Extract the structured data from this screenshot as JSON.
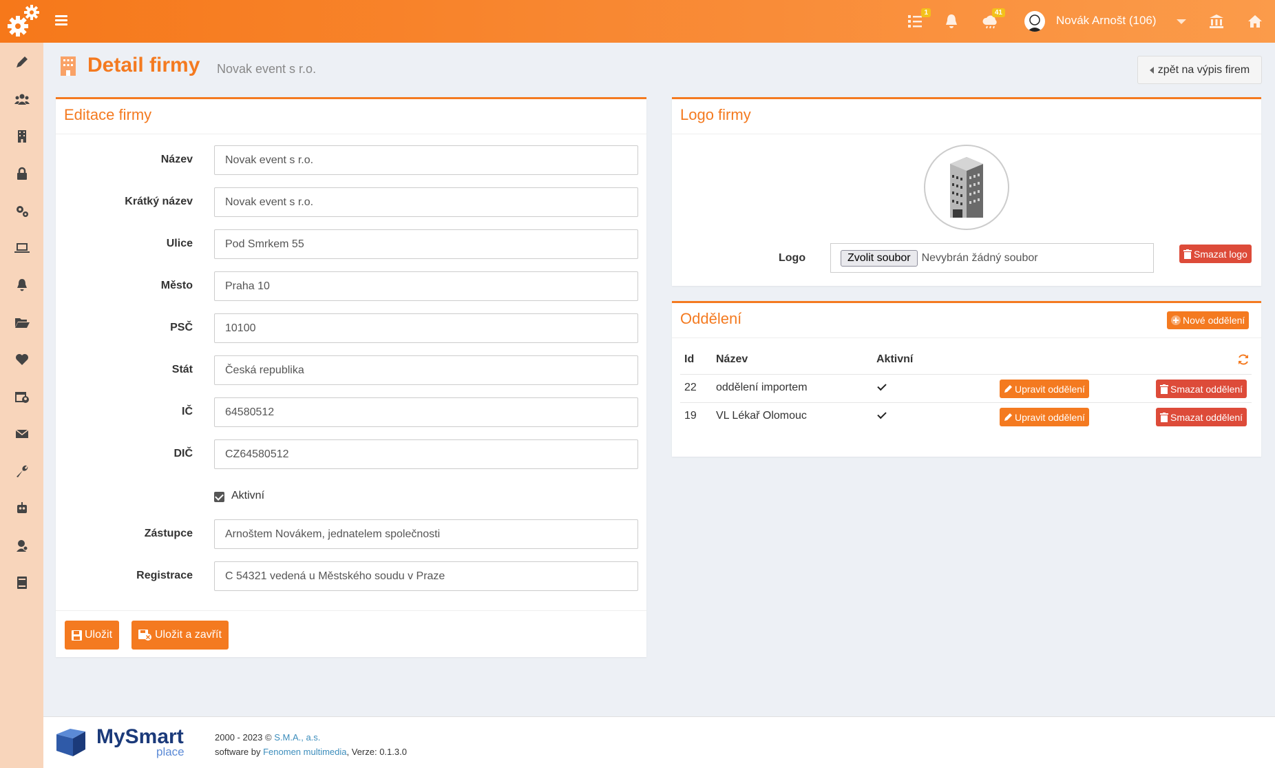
{
  "header": {
    "tasks_badge": "1",
    "weather_badge": "41",
    "user_name": "Novák Arnošt (106)"
  },
  "sidebar": {
    "icons": [
      "pencil-icon",
      "users-icon",
      "building-icon",
      "lock-icon",
      "cogs-icon",
      "laptop-icon",
      "bell-icon",
      "folder-open-icon",
      "heart-icon",
      "calendar-user-icon",
      "envelope-icon",
      "wrench-icon",
      "robot-icon",
      "user-key-icon",
      "book-icon"
    ]
  },
  "page": {
    "title": "Detail firmy",
    "subtitle": "Novak event s r.o.",
    "back_label": "zpět na výpis firem"
  },
  "edit_panel": {
    "title": "Editace firmy",
    "fields": [
      {
        "label": "Název",
        "value": "Novak event s r.o."
      },
      {
        "label": "Krátký název",
        "value": "Novak event s r.o."
      },
      {
        "label": "Ulice",
        "value": "Pod Smrkem 55"
      },
      {
        "label": "Město",
        "value": "Praha 10"
      },
      {
        "label": "PSČ",
        "value": "10100"
      },
      {
        "label": "Stát",
        "value": "Česká republika"
      },
      {
        "label": "IČ",
        "value": "64580512"
      },
      {
        "label": "DIČ",
        "value": "CZ64580512"
      }
    ],
    "active_label": "Aktivní",
    "active_checked": true,
    "fields2": [
      {
        "label": "Zástupce",
        "value": "Arnoštem Novákem, jednatelem společnosti"
      },
      {
        "label": "Registrace",
        "value": "C 54321 vedená u Městského soudu v Praze"
      }
    ],
    "save_label": "Uložit",
    "save_close_label": "Uložit a zavřít"
  },
  "logo_panel": {
    "title": "Logo firmy",
    "logo_label": "Logo",
    "file_button": "Zvolit soubor",
    "file_status": "Nevybrán žádný soubor",
    "delete_label": "Smazat logo"
  },
  "dept_panel": {
    "title": "Oddělení",
    "new_label": "Nové oddělení",
    "columns": [
      "Id",
      "Název",
      "Aktivní"
    ],
    "rows": [
      {
        "id": "22",
        "name": "oddělení importem",
        "active": true
      },
      {
        "id": "19",
        "name": "VL Lékař Olomouc",
        "active": true
      }
    ],
    "edit_label": "Upravit oddělení",
    "delete_label": "Smazat oddělení"
  },
  "footer": {
    "brand_main": "MySmart",
    "brand_sub": "place",
    "copyright_prefix": "2000 - 2023 ©",
    "company": "S.M.A., a.s.",
    "software_by": "software by",
    "vendor": "Fenomen multimedia",
    "version_text": ", Verze: 0.1.3.0"
  },
  "colors": {
    "accent": "#f47a20",
    "danger": "#dd4b39",
    "sidebar": "#f8d5bb"
  }
}
